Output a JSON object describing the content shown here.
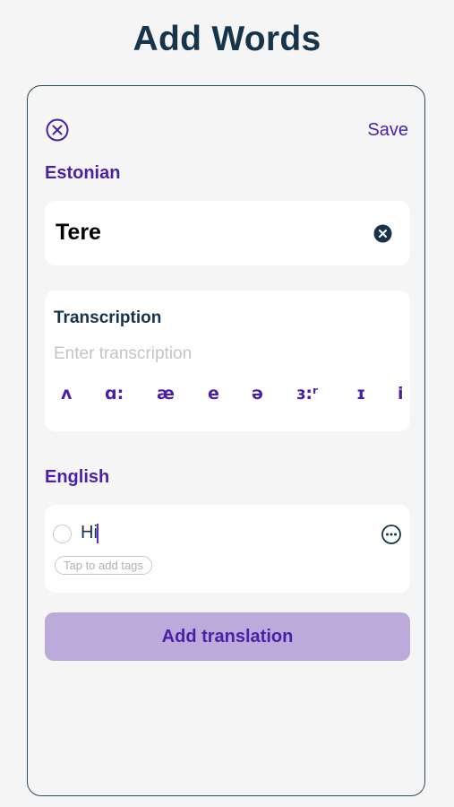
{
  "page": {
    "title": "Add Words"
  },
  "header": {
    "save_label": "Save"
  },
  "source": {
    "language_label": "Estonian",
    "word_value": "Tere"
  },
  "transcription": {
    "label": "Transcription",
    "placeholder": "Enter transcription",
    "symbols": [
      "ʌ",
      "ɑ:",
      "æ",
      "e",
      "ə",
      "ɜ:ʳ",
      "ɪ",
      "i"
    ]
  },
  "target": {
    "language_label": "English",
    "translation_value": "Hi",
    "tags_placeholder": "Tap to add tags",
    "add_translation_label": "Add translation"
  },
  "colors": {
    "accent": "#4b1fa8",
    "title": "#16344a",
    "button_bg": "#bcaadb",
    "background": "#f5f5f5"
  }
}
